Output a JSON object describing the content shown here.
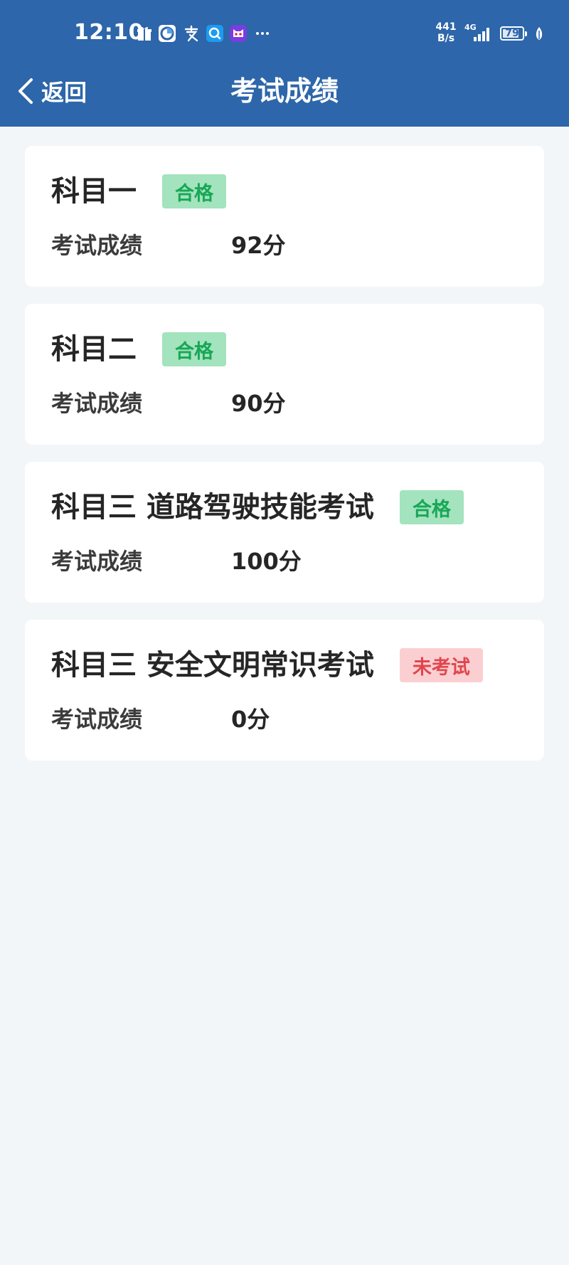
{
  "status_bar": {
    "time": "12:10",
    "net_speed_value": "441",
    "net_speed_unit": "B/s",
    "net_type": "4G",
    "battery": "79",
    "icons": [
      "gift-icon",
      "browser-icon",
      "alipay-icon",
      "search-app-icon",
      "cat-app-icon",
      "more-dots-icon"
    ]
  },
  "nav": {
    "back_label": "返回",
    "title": "考试成绩"
  },
  "results": [
    {
      "subject": "科目一",
      "status": "合格",
      "status_type": "pass",
      "score_label": "考试成绩",
      "score": "92分"
    },
    {
      "subject": "科目二",
      "status": "合格",
      "status_type": "pass",
      "score_label": "考试成绩",
      "score": "90分"
    },
    {
      "subject": "科目三 道路驾驶技能考试",
      "status": "合格",
      "status_type": "pass",
      "score_label": "考试成绩",
      "score": "100分"
    },
    {
      "subject": "科目三 安全文明常识考试",
      "status": "未考试",
      "status_type": "absent",
      "score_label": "考试成绩",
      "score": "0分"
    }
  ],
  "colors": {
    "header_bg": "#2d66aa",
    "page_bg": "#f2f6f8",
    "pass_bg": "#a3e3bd",
    "pass_text": "#18a757",
    "absent_bg": "#fbcfd1",
    "absent_text": "#e0464d"
  }
}
